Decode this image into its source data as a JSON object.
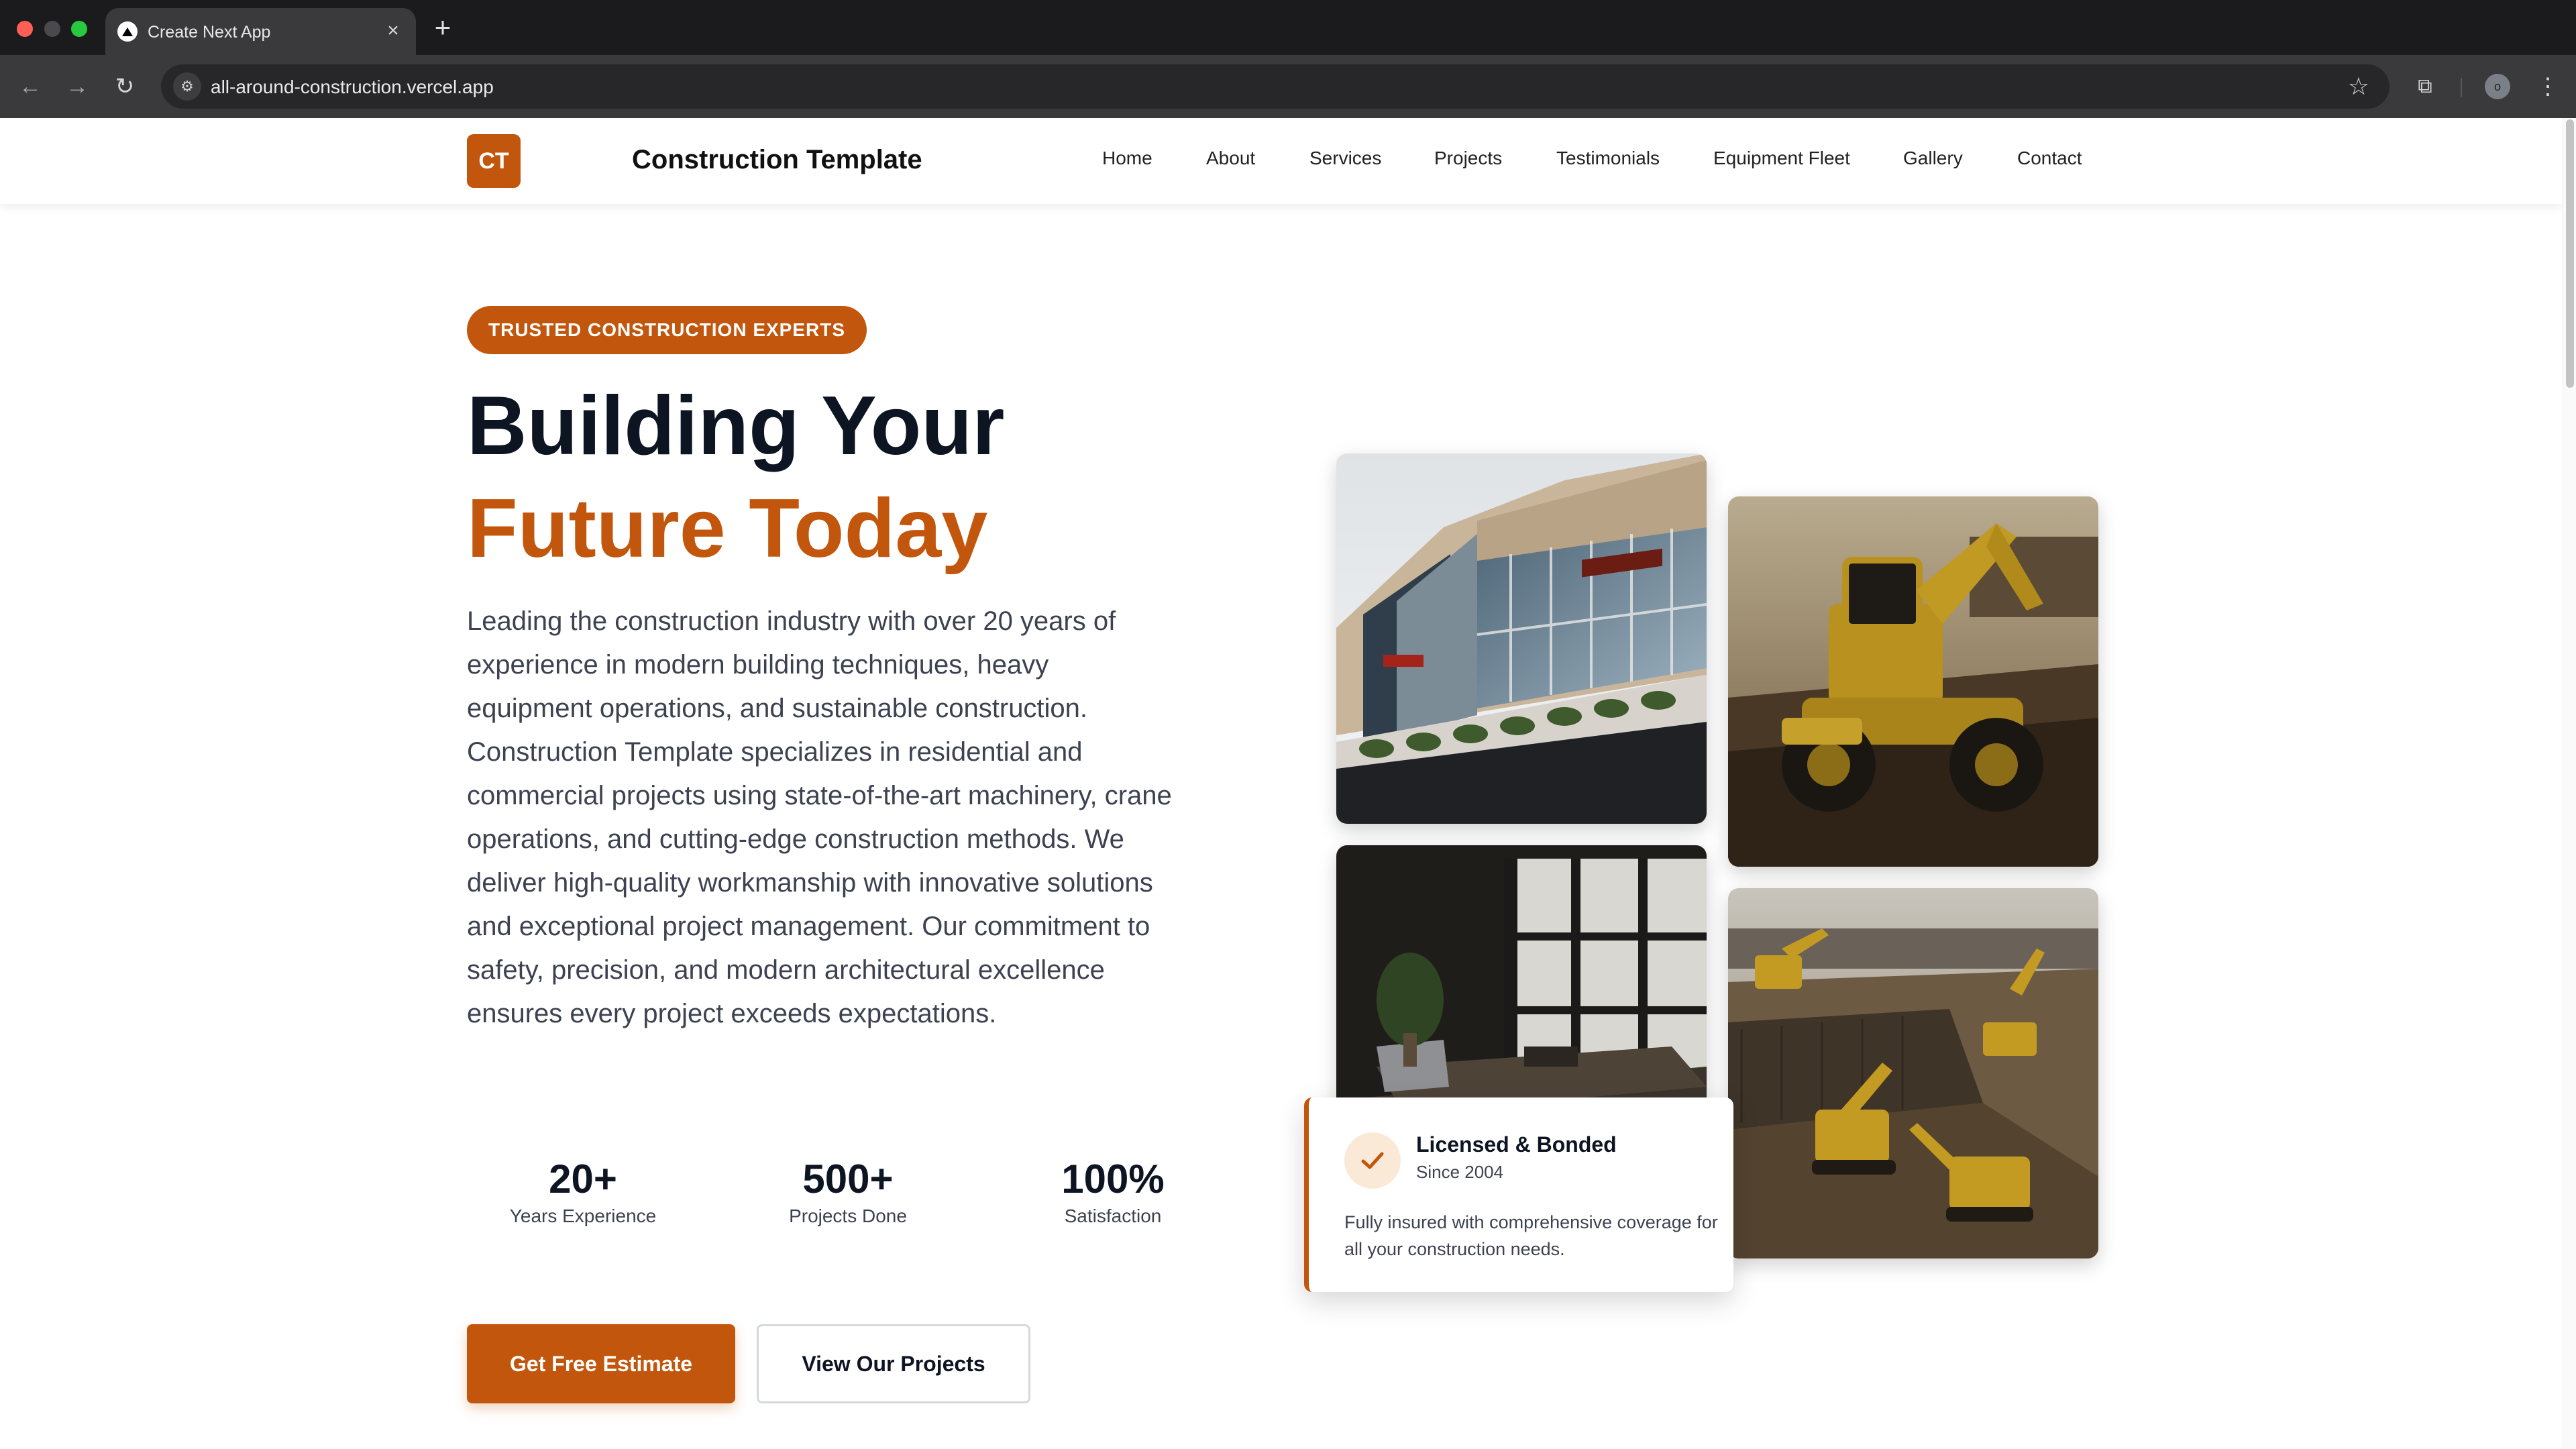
{
  "browser": {
    "tab_title": "Create Next App",
    "tab_close": "×",
    "new_tab": "+",
    "url": "all-around-construction.vercel.app",
    "profile_initial": "o"
  },
  "header": {
    "logo_text": "CT",
    "brand_name": "Construction Template",
    "nav": [
      "Home",
      "About",
      "Services",
      "Projects",
      "Testimonials",
      "Equipment Fleet",
      "Gallery",
      "Contact"
    ]
  },
  "hero": {
    "badge": "TRUSTED CONSTRUCTION EXPERTS",
    "headline_line1": "Building Your",
    "headline_line2": "Future Today",
    "lead": "Leading the construction industry with over 20 years of experience in modern building techniques, heavy equipment operations, and sustainable construction. Construction Template specializes in residential and commercial projects using state-of-the-art machinery, crane operations, and cutting-edge construction methods. We deliver high-quality workmanship with innovative solutions and exceptional project management. Our commitment to safety, precision, and modern architectural excellence ensures every project exceeds expectations.",
    "stats": [
      {
        "value": "20+",
        "label": "Years Experience"
      },
      {
        "value": "500+",
        "label": "Projects Done"
      },
      {
        "value": "100%",
        "label": "Satisfaction"
      }
    ],
    "primary_cta": "Get Free Estimate",
    "secondary_cta": "View Our Projects"
  },
  "license_card": {
    "title": "Licensed & Bonded",
    "subtitle": "Since 2004",
    "description": "Fully insured with comprehensive coverage for all your construction needs."
  },
  "colors": {
    "accent": "#c2560c",
    "heading": "#0d1422",
    "body_text": "#3c4250"
  }
}
